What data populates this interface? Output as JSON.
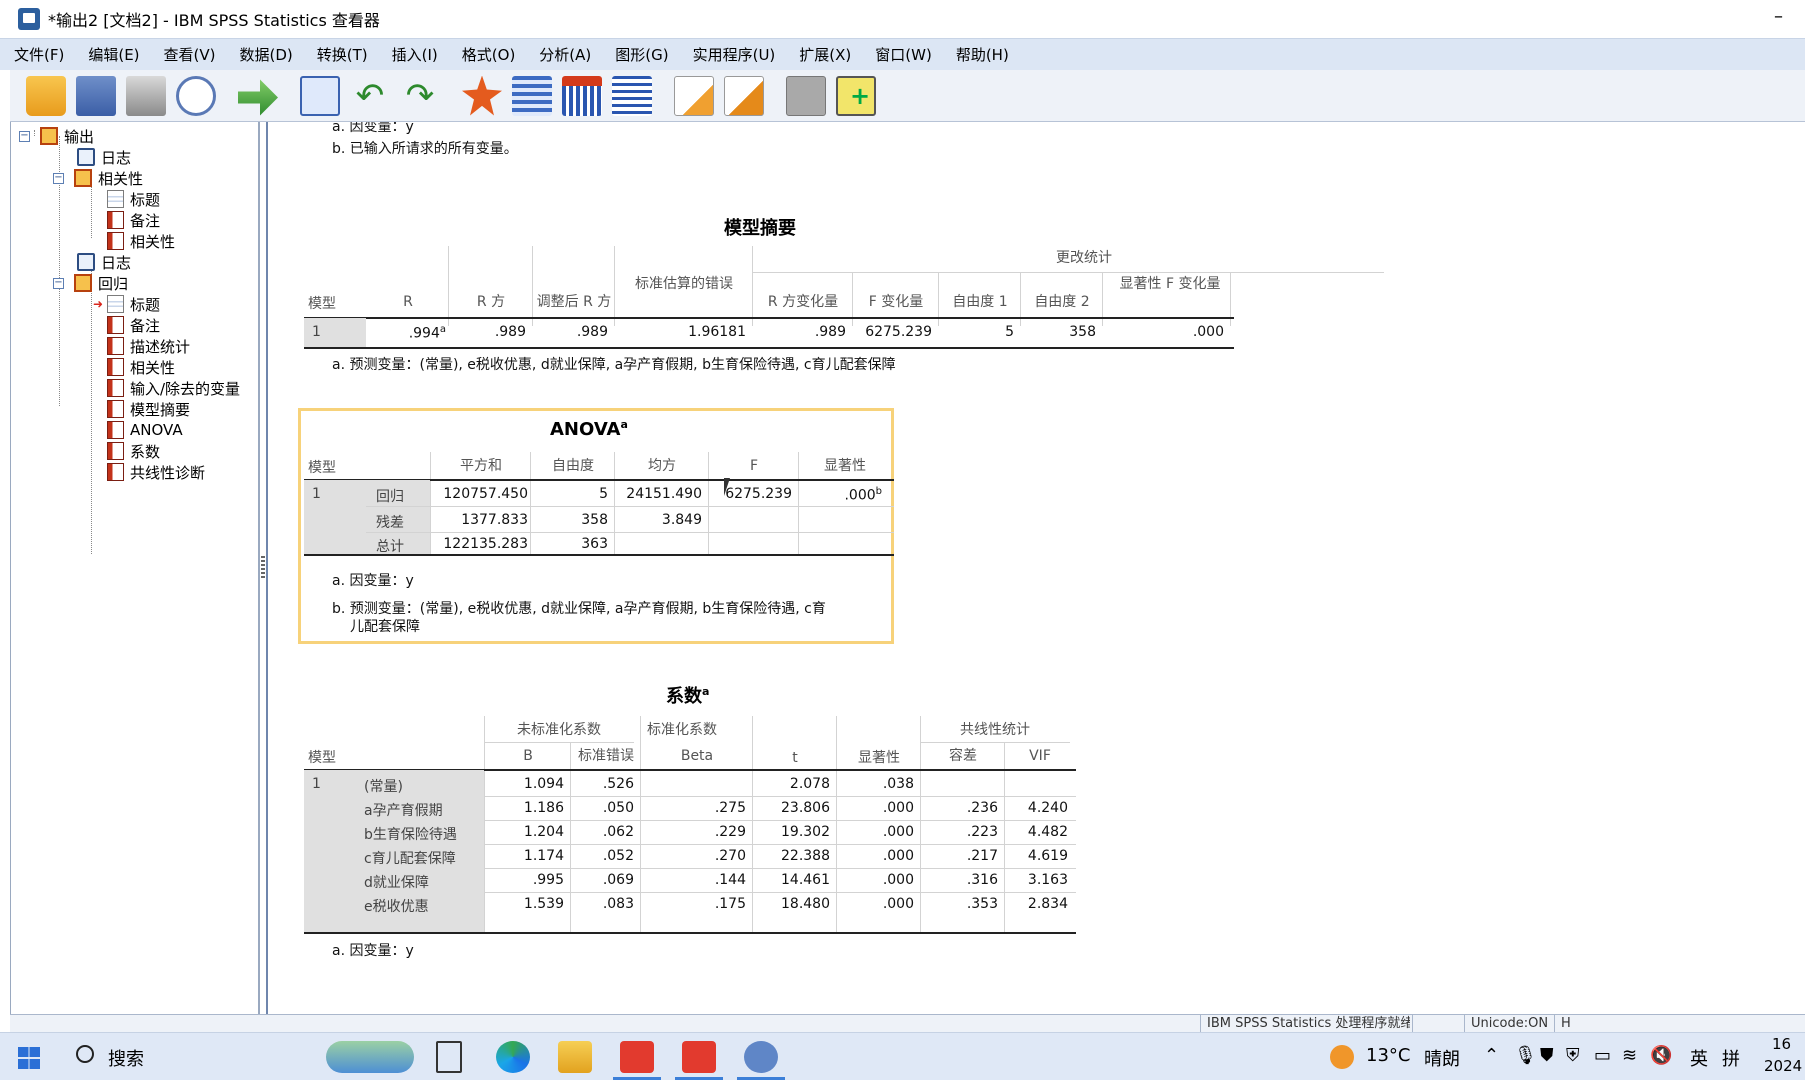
{
  "window": {
    "title": "*输出2 [文档2] - IBM SPSS Statistics 查看器",
    "minimize": "–"
  },
  "menu": [
    "文件(F)",
    "编辑(E)",
    "查看(V)",
    "数据(D)",
    "转换(T)",
    "插入(I)",
    "格式(O)",
    "分析(A)",
    "图形(G)",
    "实用程序(U)",
    "扩展(X)",
    "窗口(W)",
    "帮助(H)"
  ],
  "toolbar": [
    "open-icon",
    "save-icon",
    "print-icon",
    "print-preview-icon",
    "export-icon",
    "goto-data-icon",
    "undo-icon",
    "redo-icon",
    "goto-output-icon",
    "pivot-icon",
    "insert-output-icon",
    "table-icon",
    "script-icon",
    "run-script-icon",
    "disabled-icon",
    "add-output-icon"
  ],
  "outline": {
    "root": "输出",
    "items": [
      "日志",
      "相关性",
      "标题",
      "备注",
      "相关性",
      "日志",
      "回归",
      "标题",
      "备注",
      "描述统计",
      "相关性",
      "输入/除去的变量",
      "模型摘要",
      "ANOVA",
      "系数",
      "共线性诊断"
    ]
  },
  "top_notes": {
    "a": "a. 因变量：y",
    "b": "b. 已输入所请求的所有变量。"
  },
  "model_summary": {
    "title": "模型摘要",
    "group_header": "更改统计",
    "headers": [
      "模型",
      "R",
      "R 方",
      "调整后 R 方",
      "标准估算的错误",
      "R 方变化量",
      "F 变化量",
      "自由度 1",
      "自由度 2",
      "显著性 F 变化量"
    ],
    "row": [
      "1",
      ".994",
      ".989",
      ".989",
      "1.96181",
      ".989",
      "6275.239",
      "5",
      "358",
      ".000"
    ],
    "r_sup": "a",
    "note": "a. 预测变量：(常量), e税收优惠, d就业保障, a孕产育假期, b生育保险待遇, c育儿配套保障"
  },
  "anova": {
    "title": "ANOVA",
    "title_sup": "a",
    "headers": [
      "模型",
      "平方和",
      "自由度",
      "均方",
      "F",
      "显著性"
    ],
    "model": "1",
    "rows": [
      {
        "label": "回归",
        "ss": "120757.450",
        "df": "5",
        "ms": "24151.490",
        "f": "6275.239",
        "sig": ".000",
        "sig_sup": "b"
      },
      {
        "label": "残差",
        "ss": "1377.833",
        "df": "358",
        "ms": "3.849",
        "f": "",
        "sig": "",
        "sig_sup": ""
      },
      {
        "label": "总计",
        "ss": "122135.283",
        "df": "363",
        "ms": "",
        "f": "",
        "sig": "",
        "sig_sup": ""
      }
    ],
    "note_a": "a. 因变量：y",
    "note_b1": "b. 预测变量：(常量), e税收优惠, d就业保障, a孕产育假期, b生育保险待遇, c育",
    "note_b2": "儿配套保障"
  },
  "coefficients": {
    "title": "系数",
    "title_sup": "a",
    "group_headers": {
      "unstd": "未标准化系数",
      "std": "标准化系数",
      "collin": "共线性统计"
    },
    "headers": [
      "模型",
      "B",
      "标准错误",
      "Beta",
      "t",
      "显著性",
      "容差",
      "VIF"
    ],
    "model": "1",
    "rows": [
      {
        "label": "(常量)",
        "b": "1.094",
        "se": ".526",
        "beta": "",
        "t": "2.078",
        "sig": ".038",
        "tol": "",
        "vif": ""
      },
      {
        "label": "a孕产育假期",
        "b": "1.186",
        "se": ".050",
        "beta": ".275",
        "t": "23.806",
        "sig": ".000",
        "tol": ".236",
        "vif": "4.240"
      },
      {
        "label": "b生育保险待遇",
        "b": "1.204",
        "se": ".062",
        "beta": ".229",
        "t": "19.302",
        "sig": ".000",
        "tol": ".223",
        "vif": "4.482"
      },
      {
        "label": "c育儿配套保障",
        "b": "1.174",
        "se": ".052",
        "beta": ".270",
        "t": "22.388",
        "sig": ".000",
        "tol": ".217",
        "vif": "4.619"
      },
      {
        "label": "d就业保障",
        "b": ".995",
        "se": ".069",
        "beta": ".144",
        "t": "14.461",
        "sig": ".000",
        "tol": ".316",
        "vif": "3.163"
      },
      {
        "label": "e税收优惠",
        "b": "1.539",
        "se": ".083",
        "beta": ".175",
        "t": "18.480",
        "sig": ".000",
        "tol": ".353",
        "vif": "2.834"
      }
    ],
    "note": "a. 因变量：y"
  },
  "statusbar": {
    "processor": "IBM SPSS Statistics 处理程序就绪",
    "unicode": "Unicode:ON",
    "extra": "H"
  },
  "taskbar": {
    "search": "搜索",
    "weather_temp": "13°C",
    "weather_text": "晴朗",
    "ime": "英",
    "ime2": "拼",
    "time": "16",
    "date": "2024"
  }
}
